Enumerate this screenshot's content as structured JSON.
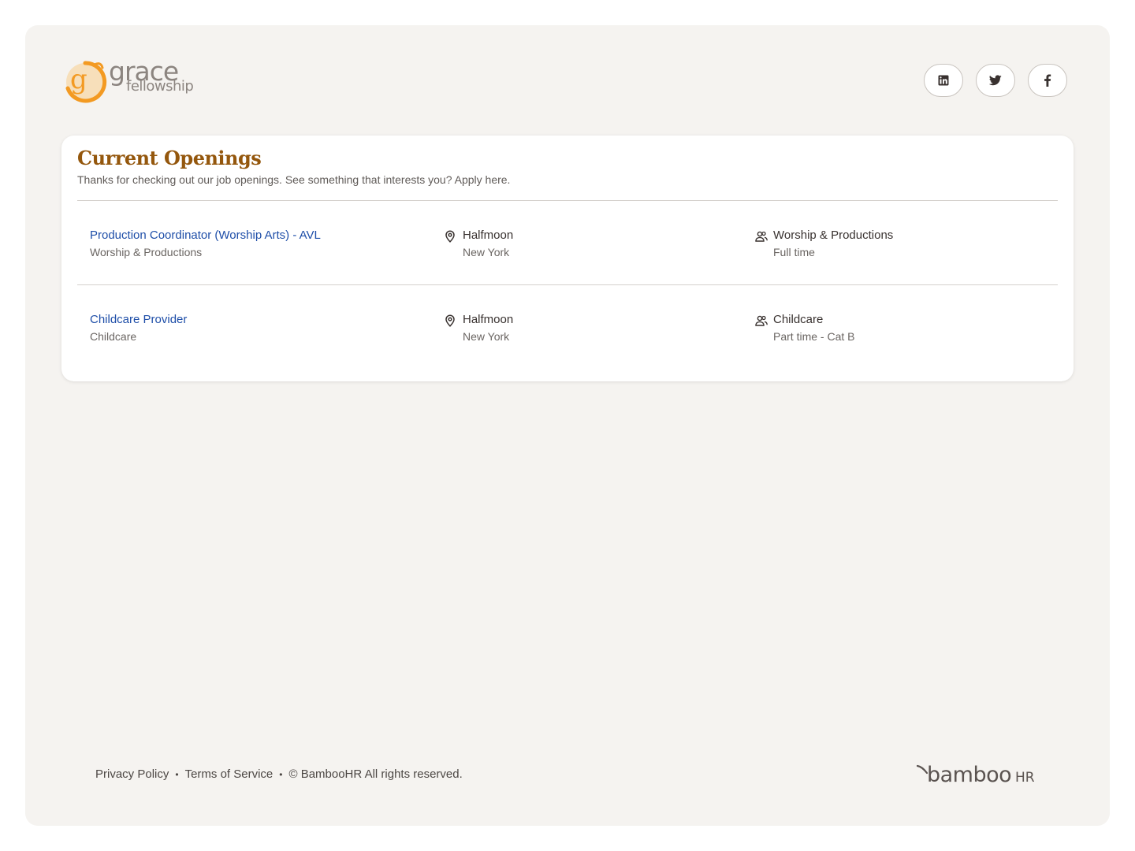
{
  "brand": {
    "logo_word1": "grace",
    "logo_word2": "fellowship",
    "logo_color": "#f39a22"
  },
  "social": [
    {
      "name": "linkedin",
      "icon": "linkedin-icon"
    },
    {
      "name": "twitter",
      "icon": "twitter-icon"
    },
    {
      "name": "facebook",
      "icon": "facebook-icon"
    }
  ],
  "openings": {
    "title": "Current Openings",
    "subtitle": "Thanks for checking out our job openings. See something that interests you? Apply here.",
    "jobs": [
      {
        "title": "Production Coordinator (Worship Arts) - AVL",
        "department": "Worship & Productions",
        "city": "Halfmoon",
        "state": "New York",
        "team": "Worship & Productions",
        "employment_type": "Full time"
      },
      {
        "title": "Childcare Provider",
        "department": "Childcare",
        "city": "Halfmoon",
        "state": "New York",
        "team": "Childcare",
        "employment_type": "Part time - Cat B"
      }
    ]
  },
  "footer": {
    "privacy": "Privacy Policy",
    "terms": "Terms of Service",
    "copyright": "© BambooHR All rights reserved.",
    "powered_logo_word": "bamboo",
    "powered_logo_suffix": "HR"
  },
  "colors": {
    "accent_title": "#94570d",
    "link": "#1e4ea8",
    "page_bg": "#f5f3f0"
  }
}
